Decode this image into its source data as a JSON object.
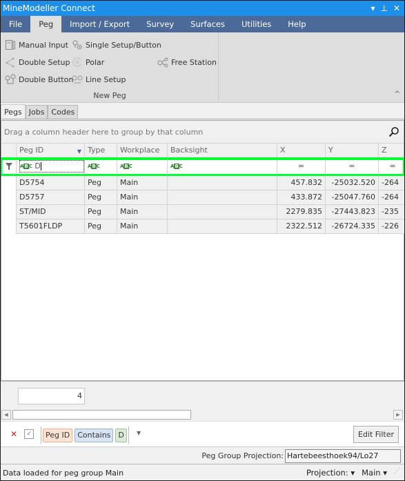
{
  "window": {
    "title": "MineModeller Connect",
    "controls": {
      "dropdown": "▾",
      "pin": "⊥",
      "close": "✕"
    }
  },
  "menu": {
    "tabs": [
      {
        "label": "File",
        "active": false
      },
      {
        "label": "Peg",
        "active": true
      },
      {
        "label": "Import / Export",
        "active": false
      },
      {
        "label": "Survey",
        "active": false
      },
      {
        "label": "Surfaces",
        "active": false
      },
      {
        "label": "Utilities",
        "active": false
      },
      {
        "label": "Help",
        "active": false
      }
    ]
  },
  "ribbon": {
    "group_label": "New Peg",
    "buttons": {
      "manual_input": {
        "label": "Manual Input",
        "icon": "manual-input-icon"
      },
      "single_setup": {
        "label": "Single Setup/Button",
        "icon": "single-setup-icon"
      },
      "double_setup": {
        "label": "Double Setup",
        "icon": "double-setup-icon"
      },
      "polar": {
        "label": "Polar",
        "icon": "polar-icon"
      },
      "free_station": {
        "label": "Free Station",
        "icon": "free-station-icon"
      },
      "double_button": {
        "label": "Double Button",
        "icon": "double-button-icon"
      },
      "line_setup": {
        "label": "Line Setup",
        "icon": "line-setup-icon"
      }
    },
    "collapse_glyph": "^"
  },
  "doc_tabs": [
    {
      "label": "Pegs",
      "active": true
    },
    {
      "label": "Jobs",
      "active": false
    },
    {
      "label": "Codes",
      "active": false
    }
  ],
  "grid": {
    "group_hint": "Drag a column header here to group by that column",
    "columns": [
      "Peg ID",
      "Type",
      "Workplace",
      "Backsight",
      "X",
      "Y",
      "Z"
    ],
    "filter_row": {
      "peg_id": "D",
      "abc_prefix": "A",
      "abc_mid": "B",
      "abc_suffix": "C",
      "eq": "="
    },
    "rows": [
      {
        "peg_id": "D5754",
        "type": "Peg",
        "workplace": "Main",
        "backsight": "",
        "x": "457.832",
        "y": "-25032.520",
        "z": "-264"
      },
      {
        "peg_id": "D5757",
        "type": "Peg",
        "workplace": "Main",
        "backsight": "",
        "x": "433.872",
        "y": "-25047.760",
        "z": "-264"
      },
      {
        "peg_id": "ST/MID",
        "type": "Peg",
        "workplace": "Main",
        "backsight": "",
        "x": "2279.835",
        "y": "-27443.823",
        "z": "-235"
      },
      {
        "peg_id": "T5601FLDP",
        "type": "Peg",
        "workplace": "Main",
        "backsight": "",
        "x": "2322.512",
        "y": "-26724.335",
        "z": "-226"
      }
    ],
    "row_count": "4"
  },
  "filter_bar": {
    "field": "Peg ID",
    "operator": "Contains",
    "value": "D",
    "enabled_check": "✓",
    "clear_glyph": "✕",
    "edit_label": "Edit Filter"
  },
  "projection": {
    "label": "Peg Group Projection:",
    "value": "Hartebeesthoek94/Lo27"
  },
  "status": {
    "message": "Data loaded for peg group Main",
    "projection_label": "Projection: ▾",
    "group_label": "Main ▾"
  }
}
